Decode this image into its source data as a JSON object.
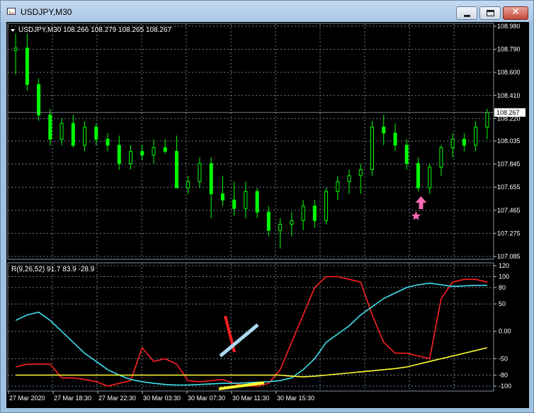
{
  "window": {
    "title": "USDJPY,M30",
    "minimize_glyph": "minimize-icon",
    "maximize_glyph": "maximize-icon",
    "close_glyph": "✕"
  },
  "main_chart": {
    "header": "USDJPY,M30  108.266 108.279 108.265 108.267",
    "current_price_label": "108.267",
    "price_axis_labels": [
      "108.980",
      "108.790",
      "108.600",
      "108.410",
      "108.220",
      "108.035",
      "107.845",
      "107.655",
      "107.465",
      "107.275",
      "107.085"
    ],
    "colors": {
      "bull": "#00ff00",
      "bear": "#ffffff",
      "background": "#000000",
      "grid": "#6f7f8f",
      "arrow": "#ff69b4"
    }
  },
  "indicator": {
    "header": "R(9,26,52) 91.7 83.9 -28.9",
    "axis_labels": [
      "120",
      "100",
      "80",
      "50",
      "0.00",
      "-50",
      "-80",
      "-100"
    ],
    "colors": {
      "red": "#ff2020",
      "cyan": "#40e0f0",
      "yellow": "#ffff30"
    }
  },
  "time_axis": {
    "labels": [
      "27 Mar 2020",
      "27 Mar 18:30",
      "27 Mar 22:30",
      "30 Mar 03:30",
      "30 Mar 07:30",
      "30 Mar 11:30",
      "30 Mar 15:30"
    ]
  },
  "chart_data": [
    {
      "type": "candlestick",
      "title": "USDJPY,M30",
      "ylim": [
        107.085,
        108.98
      ],
      "ohlc": [
        [
          108.78,
          108.92,
          108.58,
          108.8
        ],
        [
          108.8,
          108.92,
          108.45,
          108.5
        ],
        [
          108.5,
          108.55,
          108.2,
          108.25
        ],
        [
          108.25,
          108.3,
          108.0,
          108.05
        ],
        [
          108.05,
          108.22,
          108.0,
          108.18
        ],
        [
          108.18,
          108.25,
          107.98,
          108.0
        ],
        [
          108.0,
          108.2,
          107.95,
          108.15
        ],
        [
          108.15,
          108.18,
          108.0,
          108.05
        ],
        [
          108.05,
          108.1,
          107.95,
          108.0
        ],
        [
          108.0,
          108.08,
          107.8,
          107.85
        ],
        [
          107.85,
          108.0,
          107.8,
          107.95
        ],
        [
          107.95,
          108.0,
          107.88,
          107.92
        ],
        [
          107.92,
          108.05,
          107.85,
          107.98
        ],
        [
          107.98,
          108.05,
          107.93,
          107.95
        ],
        [
          107.95,
          108.08,
          107.8,
          107.65
        ],
        [
          107.65,
          107.75,
          107.6,
          107.7
        ],
        [
          107.7,
          107.9,
          107.65,
          107.85
        ],
        [
          107.85,
          107.9,
          107.4,
          107.6
        ],
        [
          107.6,
          107.75,
          107.5,
          107.55
        ],
        [
          107.55,
          107.7,
          107.42,
          107.48
        ],
        [
          107.48,
          107.7,
          107.4,
          107.62
        ],
        [
          107.62,
          107.65,
          107.4,
          107.45
        ],
        [
          107.45,
          107.5,
          107.25,
          107.3
        ],
        [
          107.3,
          107.4,
          107.15,
          107.35
        ],
        [
          107.35,
          107.45,
          107.25,
          107.38
        ],
        [
          107.38,
          107.55,
          107.3,
          107.5
        ],
        [
          107.5,
          107.55,
          107.32,
          107.38
        ],
        [
          107.38,
          107.65,
          107.35,
          107.62
        ],
        [
          107.62,
          107.75,
          107.55,
          107.7
        ],
        [
          107.7,
          107.8,
          107.6,
          107.75
        ],
        [
          107.75,
          107.85,
          107.6,
          107.8
        ],
        [
          107.8,
          108.2,
          107.75,
          108.15
        ],
        [
          108.15,
          108.25,
          108.0,
          108.1
        ],
        [
          108.1,
          108.18,
          107.95,
          108.0
        ],
        [
          108.0,
          108.05,
          107.8,
          107.85
        ],
        [
          107.85,
          107.9,
          107.62,
          107.65
        ],
        [
          107.65,
          107.85,
          107.6,
          107.82
        ],
        [
          107.82,
          108.0,
          107.75,
          107.98
        ],
        [
          107.98,
          108.1,
          107.9,
          108.05
        ],
        [
          108.05,
          108.1,
          107.95,
          108.0
        ],
        [
          108.0,
          108.2,
          107.95,
          108.15
        ],
        [
          108.15,
          108.3,
          108.05,
          108.27
        ]
      ]
    },
    {
      "type": "line",
      "title": "R(9,26,52)",
      "ylim": [
        -100,
        120
      ],
      "series": [
        {
          "name": "",
          "color": "#ff2020",
          "values": [
            -65,
            -60,
            -60,
            -60,
            -85,
            -85,
            -88,
            -92,
            -100,
            -95,
            -90,
            -30,
            -55,
            -50,
            -60,
            -90,
            -92,
            -90,
            -88,
            -95,
            -100,
            -100,
            -95,
            -70,
            -20,
            30,
            80,
            100,
            100,
            95,
            90,
            30,
            -20,
            -40,
            -40,
            -45,
            -50,
            60,
            90,
            95,
            95,
            90
          ]
        },
        {
          "name": "",
          "color": "#40e0f0",
          "values": [
            20,
            30,
            35,
            20,
            0,
            -20,
            -40,
            -55,
            -70,
            -80,
            -88,
            -92,
            -95,
            -97,
            -98,
            -98,
            -97,
            -96,
            -95,
            -95,
            -94,
            -93,
            -92,
            -90,
            -85,
            -70,
            -50,
            -20,
            -5,
            10,
            30,
            45,
            60,
            70,
            80,
            85,
            88,
            85,
            82,
            83,
            84,
            84
          ]
        },
        {
          "name": "",
          "color": "#ffff30",
          "values": [
            -80,
            -80,
            -80,
            -80,
            -80,
            -80,
            -80,
            -80,
            -80,
            -80,
            -80,
            -80,
            -80,
            -80,
            -80,
            -80,
            -80,
            -80,
            -80,
            -80,
            -80,
            -80,
            -80,
            -80,
            -82,
            -83,
            -82,
            -80,
            -78,
            -76,
            -74,
            -72,
            -70,
            -68,
            -65,
            -60,
            -55,
            -50,
            -45,
            -40,
            -35,
            -30
          ]
        }
      ]
    }
  ]
}
